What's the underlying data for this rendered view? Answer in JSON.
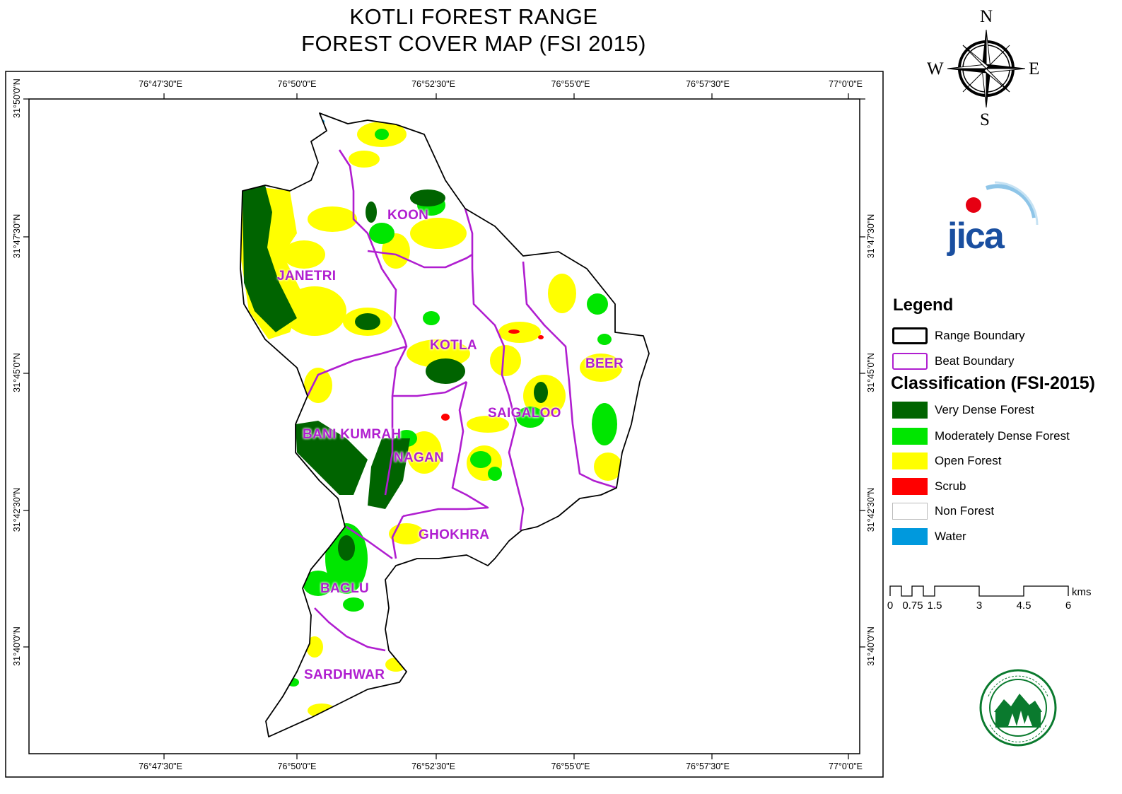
{
  "title": {
    "line1": "KOTLI FOREST RANGE",
    "line2": "FOREST COVER MAP (FSI 2015)"
  },
  "grid": {
    "longitude_ticks": [
      "76°47'30\"E",
      "76°50'0\"E",
      "76°52'30\"E",
      "76°55'0\"E",
      "76°57'30\"E",
      "77°0'0\"E"
    ],
    "latitude_ticks": [
      "31°50'0\"N",
      "31°47'30\"N",
      "31°45'0\"N",
      "31°42'30\"N",
      "31°40'0\"N"
    ]
  },
  "beats": [
    "KOON",
    "JANETRI",
    "KOTLA",
    "BEER",
    "SAIGALOO",
    "BANI KUMRAH",
    "NAGAN",
    "GHOKHRA",
    "BAGLU",
    "SARDHWAR"
  ],
  "compass": {
    "n": "N",
    "s": "S",
    "e": "E",
    "w": "W"
  },
  "logos": {
    "jica": "JICA",
    "forest_department_seal": "Forest Department seal"
  },
  "legend": {
    "title": "Legend",
    "boundaries": [
      {
        "label": "Range Boundary",
        "color": "#000000"
      },
      {
        "label": "Beat Boundary",
        "color": "#b01ed0"
      }
    ],
    "classification_title": "Classification (FSI-2015)",
    "classes": [
      {
        "label": "Very Dense Forest",
        "color": "#006400"
      },
      {
        "label": "Moderately Dense Forest",
        "color": "#00e600"
      },
      {
        "label": "Open Forest",
        "color": "#ffff00"
      },
      {
        "label": "Scrub",
        "color": "#ff0000"
      },
      {
        "label": "Non Forest",
        "color": "#ffffff"
      },
      {
        "label": "Water",
        "color": "#0099dd"
      }
    ]
  },
  "scalebar": {
    "ticks": [
      "0",
      "0.75",
      "1.5",
      "3",
      "4.5",
      "6"
    ],
    "unit": "kms"
  }
}
